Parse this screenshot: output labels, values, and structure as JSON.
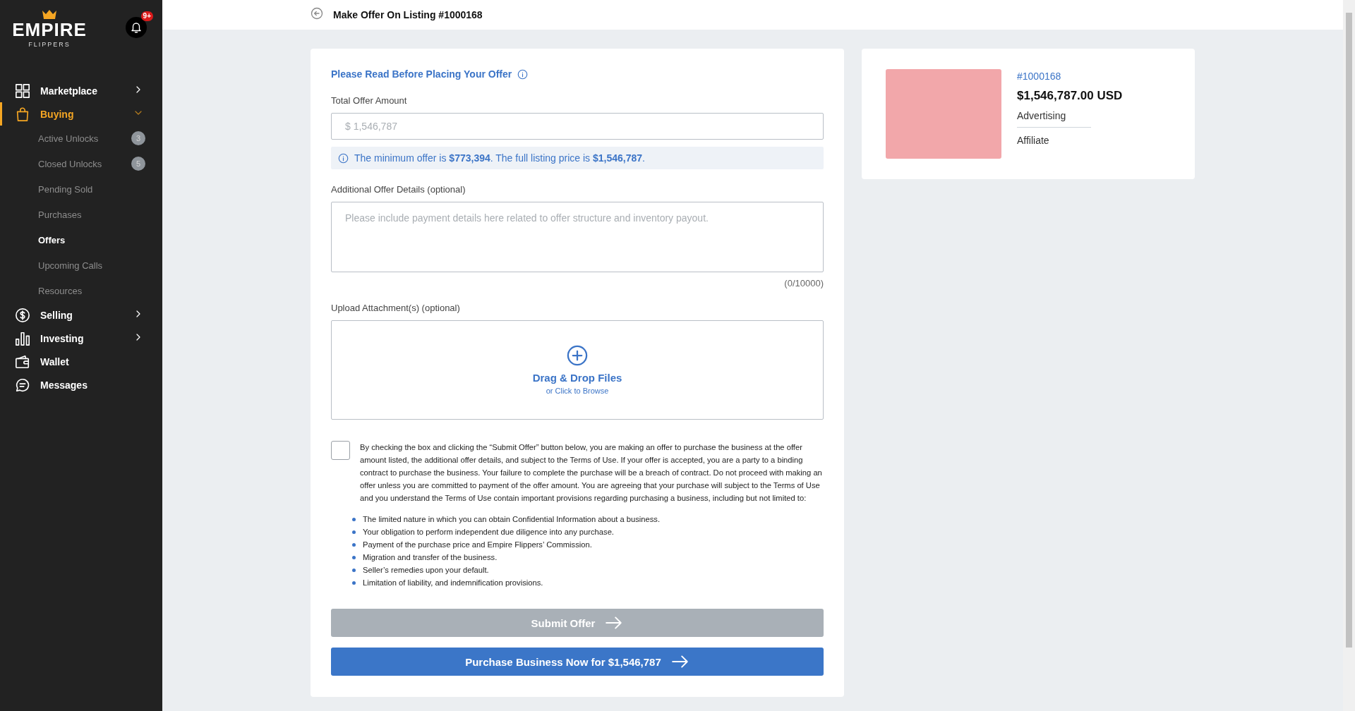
{
  "logo": {
    "word": "EMPIRE",
    "subword": "FLIPPERS"
  },
  "notifications": {
    "badge": "9+"
  },
  "sidebar": {
    "items": [
      {
        "label": "Marketplace",
        "kind": "section",
        "selected": false,
        "expanded": false
      },
      {
        "label": "Buying",
        "kind": "section",
        "selected": true,
        "expanded": true,
        "children": [
          {
            "label": "Active Unlocks",
            "selected": false,
            "badge": "3"
          },
          {
            "label": "Closed Unlocks",
            "selected": false,
            "badge": "5"
          },
          {
            "label": "Pending Sold",
            "selected": false
          },
          {
            "label": "Purchases",
            "selected": false
          },
          {
            "label": "Offers",
            "selected": true
          },
          {
            "label": "Upcoming Calls",
            "selected": false
          },
          {
            "label": "Resources",
            "selected": false
          }
        ]
      },
      {
        "label": "Selling",
        "kind": "section",
        "selected": false,
        "expanded": false
      },
      {
        "label": "Investing",
        "kind": "section",
        "selected": false,
        "expanded": false
      },
      {
        "label": "Wallet",
        "kind": "link",
        "selected": false
      },
      {
        "label": "Messages",
        "kind": "link",
        "selected": false
      }
    ]
  },
  "header": {
    "title": "Make Offer On Listing #1000168"
  },
  "form": {
    "notice": "Please Read Before Placing Your Offer",
    "amount_label": "Total Offer Amount",
    "amount_placeholder": "$ 1,546,787",
    "info": "The minimum offer is **$773,394**. The full listing price is **$1,546,787**.",
    "details_label": "Additional Offer Details (optional)",
    "details_placeholder": "Please include payment details here related to offer structure and inventory payout.",
    "details_counter": "(0/10000)",
    "upload_label": "Upload Attachment(s) (optional)",
    "upload_title": "Drag & Drop Files",
    "upload_hint": "or Click to Browse",
    "agreement": {
      "checked": false,
      "text": "By checking the box and clicking the “Submit Offer” button below, you are making an offer to purchase the business at the offer amount listed, the additional offer details, and subject to the Terms of Use. If your offer is accepted, you are a party to a binding contract to purchase the business. Your failure to complete the purchase will be a breach of contract. Do not proceed with making an offer unless you are committed to payment of the offer amount. You are agreeing that your purchase will subject to the Terms of Use and you understand the Terms of Use contain important provisions regarding purchasing a business, including but not limited to:"
    },
    "provisions": [
      "The limited nature in which you can obtain Confidential Information about a business.",
      "Your obligation to perform independent due diligence into any purchase.",
      "Payment of the purchase price and Empire Flippers’ Commission.",
      "Migration and transfer of the business.",
      "Seller’s remedies upon your default.",
      "Limitation of liability, and indemnification provisions."
    ],
    "submit": {
      "label": "Submit Offer",
      "disabled": true
    },
    "purchase": {
      "label": "Purchase Business Now for $1,546,787",
      "disabled": false
    }
  },
  "listing": {
    "id": "#1000168",
    "price": "$1,546,787.00 USD",
    "niche": "Advertising",
    "monetization": "Affiliate"
  }
}
